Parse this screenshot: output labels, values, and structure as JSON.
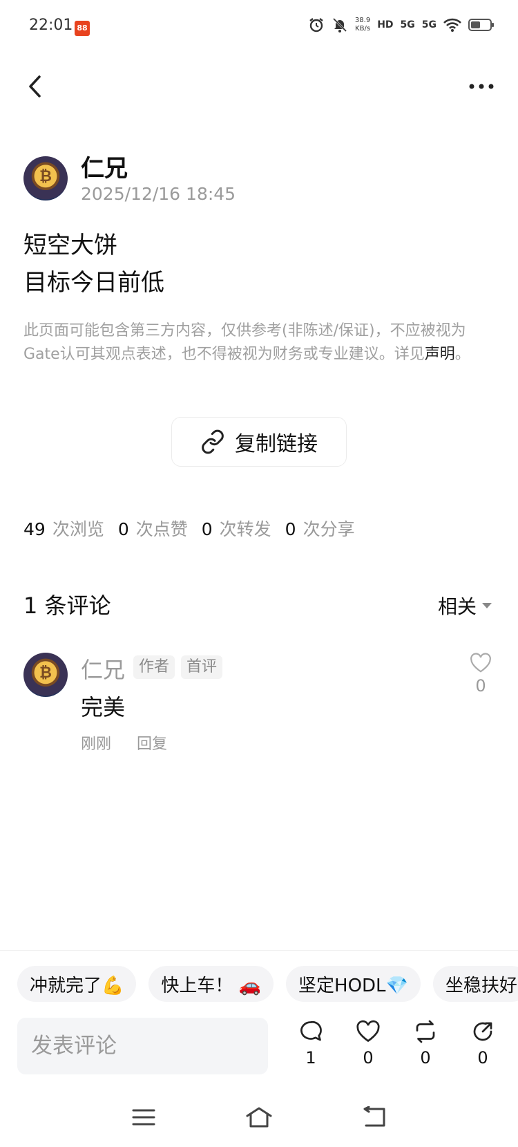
{
  "status_bar": {
    "time": "22:01",
    "app_badge": "88",
    "net_speed_value": "38.9",
    "net_speed_unit": "KB/s",
    "hd_label": "HD",
    "signal1": "5G",
    "signal2": "5G",
    "battery_level": 0.5,
    "icons": [
      "alarm-icon",
      "mute-icon",
      "wifi-icon",
      "battery-icon"
    ]
  },
  "header": {
    "back_icon": "chevron-left-icon",
    "more_icon": "more-horizontal-icon"
  },
  "post": {
    "author": "仁兄",
    "date": "2025/12/16 18:45",
    "lines": [
      "短空大饼",
      "目标今日前低"
    ],
    "disclaimer": "此页面可能包含第三方内容，仅供参考(非陈述/保证)，不应被视为Gate认可其观点表述，也不得被视为财务或专业建议。详见",
    "disclaimer_link": "声明",
    "disclaimer_end": "。",
    "copy_link_label": "复制链接",
    "avatar_glyph": "₿"
  },
  "stats": {
    "views": "49",
    "views_label": "次浏览",
    "likes": "0",
    "likes_label": "次点赞",
    "reposts": "0",
    "reposts_label": "次转发",
    "shares": "0",
    "shares_label": "次分享"
  },
  "comments": {
    "header": "1 条评论",
    "sort_label": "相关",
    "items": [
      {
        "author": "仁兄",
        "tag_author": "作者",
        "tag_first": "首评",
        "text": "完美",
        "time": "刚刚",
        "reply_label": "回复",
        "likes": "0"
      }
    ]
  },
  "quick_replies": [
    "冲就完了💪",
    "快上车！ 🚗",
    "坚定HODL💎",
    "坐稳扶好"
  ],
  "comment_input": {
    "placeholder": "发表评论"
  },
  "actions": {
    "comments": "1",
    "likes": "0",
    "reposts": "0",
    "shares": "0"
  },
  "nav_bar": {
    "icons": [
      "menu-icon",
      "home-icon",
      "back-icon"
    ]
  }
}
